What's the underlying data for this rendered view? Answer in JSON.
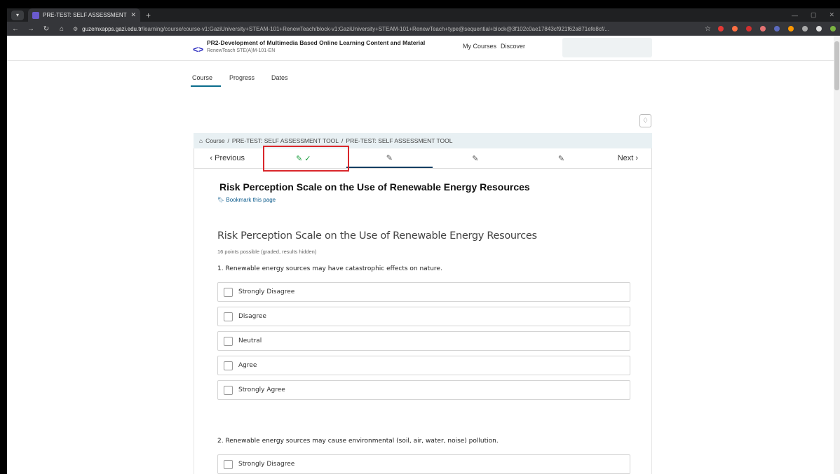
{
  "browser": {
    "tab_title": "PRE-TEST: SELF ASSESSMENT T",
    "new_tab": "+",
    "url_host": "guzemxapps.gazi.edu.tr",
    "url_path": "/learning/course/course-v1:GaziUniversity+STEAM-101+RenewTeach/block-v1:GaziUniversity+STEAM-101+RenewTeach+type@sequential+block@3f102c0ae17843cf921f62a871efe8cf/...",
    "star": "☆"
  },
  "header": {
    "logo": "<>",
    "course_title": "PR2-Development of Multimedia Based Online Learning Content and Material",
    "course_subtitle": "RenewTeach STE(A)M-101-EN",
    "link_my_courses": "My Courses",
    "link_discover": "Discover"
  },
  "course_tabs": [
    "Course",
    "Progress",
    "Dates"
  ],
  "breadcrumb": {
    "home_icon": "⌂",
    "items": [
      "Course",
      "PRE-TEST: SELF ASSESSMENT TOOL",
      "PRE-TEST: SELF ASSESSMENT TOOL"
    ],
    "sep": "/"
  },
  "seqnav": {
    "previous": "‹  Previous",
    "next": "Next  ›",
    "done_unit": "✎ ✓",
    "unit_icon": "✎"
  },
  "unit": {
    "title": "Risk Perception Scale on the Use of Renewable Energy Resources",
    "bookmark": "Bookmark this page",
    "problem_title": "Risk Perception Scale on the Use of Renewable Energy Resources",
    "points": "16 points possible (graded, results hidden)"
  },
  "questions": [
    {
      "text": "1. Renewable energy sources may have catastrophic effects on nature.",
      "options": [
        "Strongly Disagree",
        "Disagree",
        "Neutral",
        "Agree",
        "Strongly Agree"
      ]
    },
    {
      "text": "2. Renewable energy sources may cause environmental (soil, air, water, noise) pollution.",
      "options": [
        "Strongly Disagree"
      ]
    }
  ]
}
